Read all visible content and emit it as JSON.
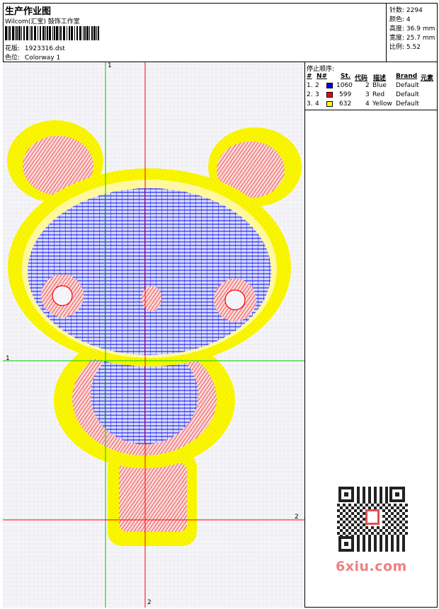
{
  "header": {
    "title": "生产作业图",
    "company": "Wilcom(汇宝) 鼓饰工作室",
    "design_label": "花版:",
    "design_value": "1923316.dst",
    "colorway_label": "色位:",
    "colorway_value": "Colorway 1"
  },
  "stats": [
    {
      "label": "针数:",
      "value": "2294"
    },
    {
      "label": "颜色:",
      "value": "4"
    },
    {
      "label": "高度:",
      "value": "36.9 mm"
    },
    {
      "label": "宽度:",
      "value": "25.7 mm"
    },
    {
      "label": "比例:",
      "value": "5.52"
    }
  ],
  "stop_sequence": {
    "title": "停止顺序:",
    "columns": [
      "#",
      "N#",
      "St.",
      "代码",
      "描述",
      "Brand",
      "元素"
    ],
    "rows": [
      {
        "num": "1.",
        "n": "2",
        "color": "#0000ff",
        "stitches": "1060",
        "code": "2",
        "desc": "Blue",
        "brand": "Default"
      },
      {
        "num": "2.",
        "n": "3",
        "color": "#ff0000",
        "stitches": "599",
        "code": "3",
        "desc": "Red",
        "brand": "Default"
      },
      {
        "num": "3.",
        "n": "4",
        "color": "#ffff00",
        "stitches": "632",
        "code": "4",
        "desc": "Yellow",
        "brand": "Default"
      }
    ]
  },
  "axes": {
    "v1": "1",
    "h1": "1",
    "h2": "2",
    "v2": "2"
  },
  "watermark": "6xiu.com",
  "colors": {
    "blue": "#0000ff",
    "red": "#ff0000",
    "yellow": "#ffff00",
    "green": "#00cc00",
    "guide_red": "#ff0000"
  }
}
